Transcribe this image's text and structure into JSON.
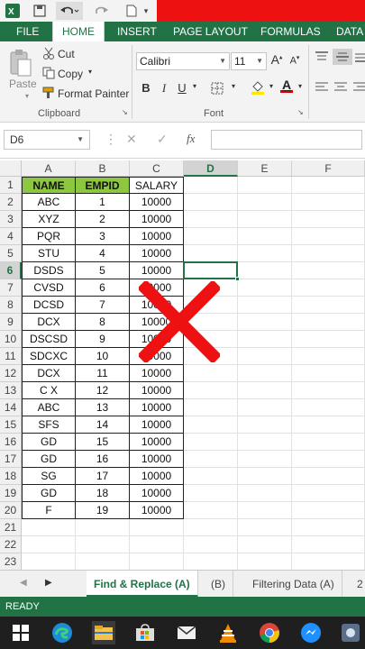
{
  "qat": {
    "excel_icon": "excel-logo-icon",
    "save_icon": "save-icon",
    "undo_icon": "undo-icon",
    "redo_icon": "redo-icon",
    "new_icon": "new-document-icon"
  },
  "ribbon_tabs": [
    "FILE",
    "HOME",
    "INSERT",
    "PAGE LAYOUT",
    "FORMULAS",
    "DATA"
  ],
  "clipboard": {
    "paste": "Paste",
    "cut": "Cut",
    "copy": "Copy",
    "format_painter": "Format Painter",
    "group": "Clipboard"
  },
  "font": {
    "name": "Calibri",
    "size": "11",
    "grow": "A",
    "shrink": "A",
    "bold": "B",
    "italic": "I",
    "underline": "U",
    "color_letter": "A",
    "group": "Font"
  },
  "formula_bar": {
    "name_box": "D6",
    "cancel": "✕",
    "enter": "✓",
    "fx": "fx",
    "value": ""
  },
  "columns": [
    "A",
    "B",
    "C",
    "D",
    "E",
    "F"
  ],
  "rows": [
    "1",
    "2",
    "3",
    "4",
    "5",
    "6",
    "7",
    "8",
    "9",
    "10",
    "11",
    "12",
    "13",
    "14",
    "15",
    "16",
    "17",
    "18",
    "19",
    "20",
    "21",
    "22",
    "23"
  ],
  "table": {
    "headers": [
      "NAME",
      "EMPID",
      "SALARY"
    ],
    "rows": [
      [
        "ABC",
        "1",
        "10000"
      ],
      [
        "XYZ",
        "2",
        "10000"
      ],
      [
        "PQR",
        "3",
        "10000"
      ],
      [
        "STU",
        "4",
        "10000"
      ],
      [
        "DSDS",
        "5",
        "10000"
      ],
      [
        "CVSD",
        "6",
        "10000"
      ],
      [
        "DCSD",
        "7",
        "10000"
      ],
      [
        "DCX",
        "8",
        "10000"
      ],
      [
        "DSCSD",
        "9",
        "10000"
      ],
      [
        "SDCXC",
        "10",
        "10000"
      ],
      [
        "DCX",
        "11",
        "10000"
      ],
      [
        "C X",
        "12",
        "10000"
      ],
      [
        "ABC",
        "13",
        "10000"
      ],
      [
        "SFS",
        "14",
        "10000"
      ],
      [
        "GD",
        "15",
        "10000"
      ],
      [
        "GD",
        "16",
        "10000"
      ],
      [
        "SG",
        "17",
        "10000"
      ],
      [
        "GD",
        "18",
        "10000"
      ],
      [
        "F",
        "19",
        "10000"
      ]
    ]
  },
  "active_cell": "D6",
  "sheet_tabs": [
    "Find & Replace (A)",
    "(B)",
    "Filtering Data (A)",
    "2"
  ],
  "status": "READY",
  "taskbar_icons": [
    "windows-start-icon",
    "edge-icon",
    "file-explorer-icon",
    "store-icon",
    "mail-icon",
    "vlc-icon",
    "chrome-icon",
    "messenger-icon",
    "app-icon"
  ],
  "colors": {
    "excel_green": "#217346",
    "header_fill": "#8dc63f",
    "cross_red": "#ee1111"
  }
}
